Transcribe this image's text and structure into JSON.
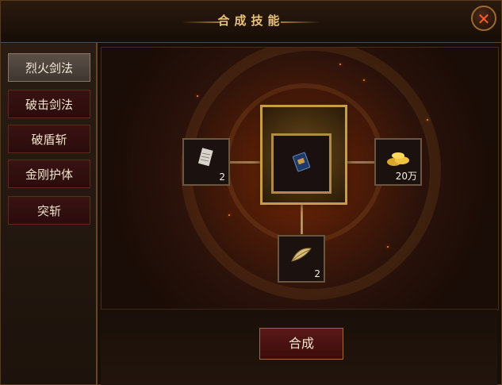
{
  "window": {
    "title": "合成技能",
    "close_label": "✕"
  },
  "sidebar": {
    "items": [
      {
        "label": "烈火剑法",
        "active": true
      },
      {
        "label": "破击剑法",
        "active": false
      },
      {
        "label": "破盾斩",
        "active": false
      },
      {
        "label": "金刚护体",
        "active": false
      },
      {
        "label": "突斩",
        "active": false
      }
    ]
  },
  "materials": {
    "left": {
      "icon": "scroll-icon",
      "qty": "2"
    },
    "center": {
      "icon": "skill-book-icon"
    },
    "right": {
      "icon": "gold-coins-icon",
      "qty": "20万"
    },
    "bottom": {
      "icon": "feather-material-icon",
      "qty": "2"
    }
  },
  "action": {
    "synthesize_label": "合成"
  },
  "colors": {
    "accent": "#c89a4a",
    "close": "#ff5a2a",
    "button": "#5a1818"
  }
}
